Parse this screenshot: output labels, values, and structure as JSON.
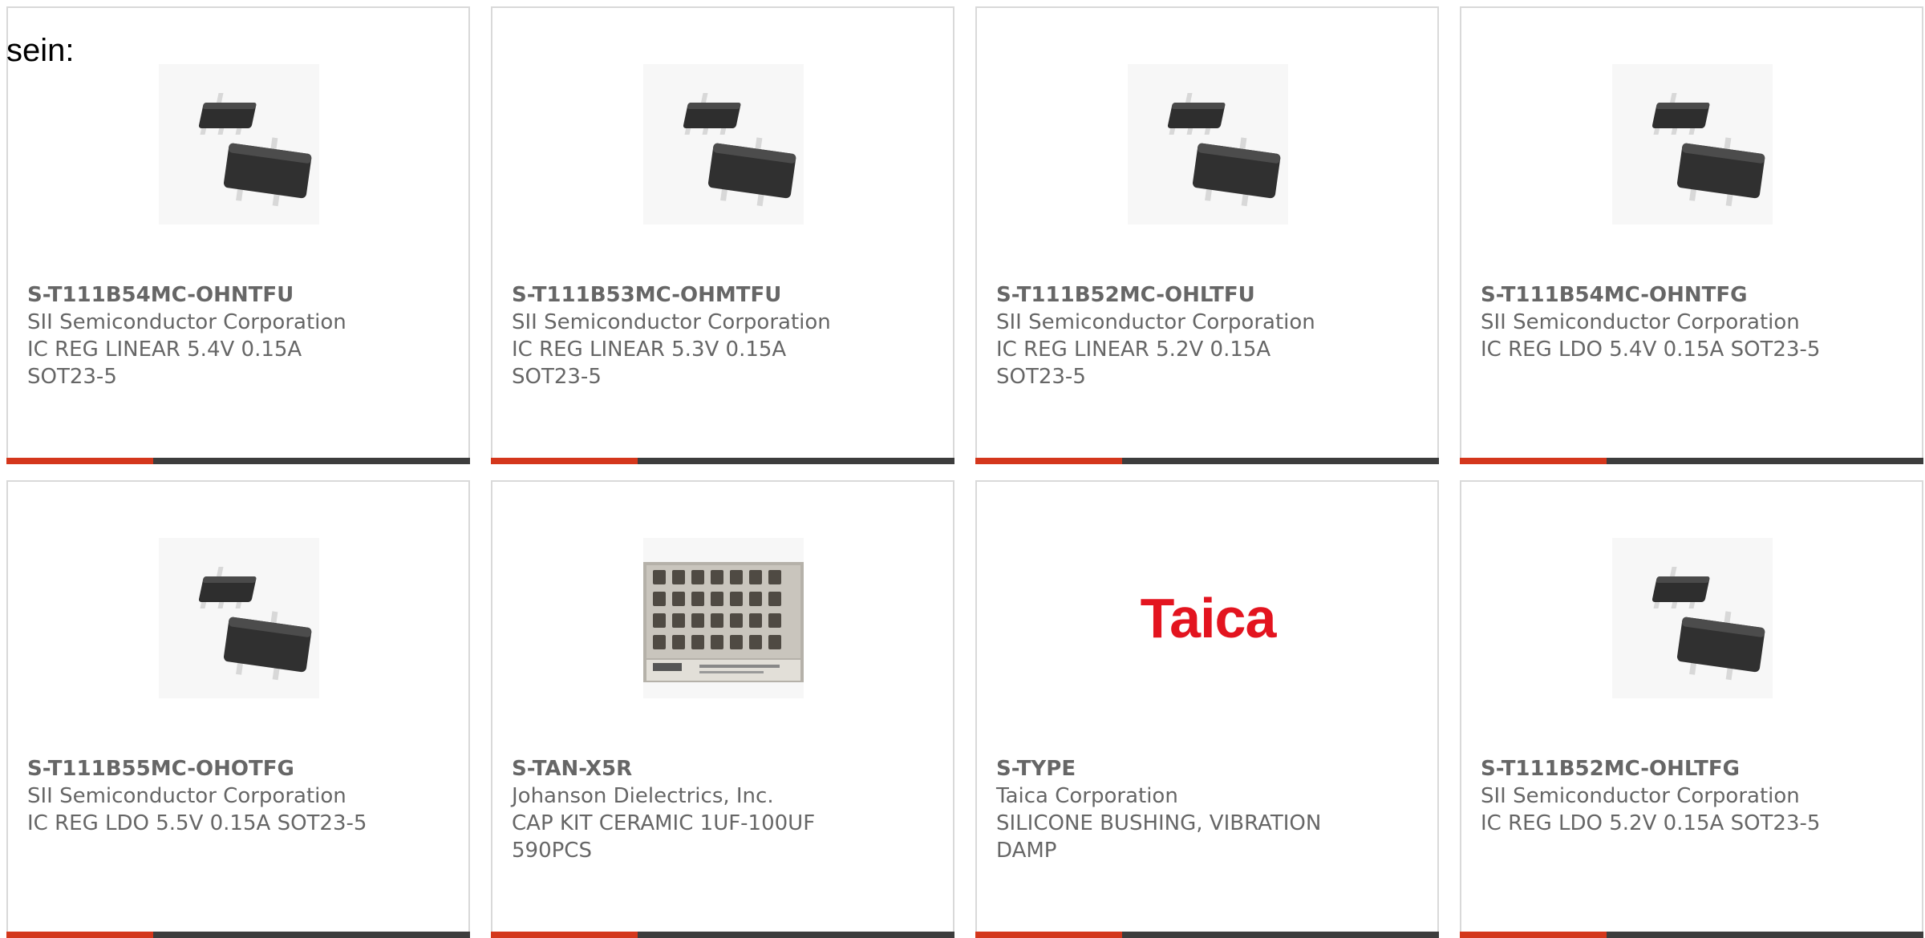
{
  "page": {
    "fragment_label": "sein:"
  },
  "colors": {
    "accent_bar": "#d4371c",
    "dark_bar": "#3d3d3d",
    "text": "#666666",
    "card_border": "#d9d9d9",
    "taica_red": "#e3141f"
  },
  "products": [
    {
      "part": "S-T111B54MC-OHNTFU",
      "manufacturer": "SII Semiconductor Corporation",
      "description": "IC REG LINEAR 5.4V 0.15A SOT23-5",
      "image": "sot23-5-package-icon"
    },
    {
      "part": "S-T111B53MC-OHMTFU",
      "manufacturer": "SII Semiconductor Corporation",
      "description": "IC REG LINEAR 5.3V 0.15A SOT23-5",
      "image": "sot23-5-package-icon"
    },
    {
      "part": "S-T111B52MC-OHLTFU",
      "manufacturer": "SII Semiconductor Corporation",
      "description": "IC REG LINEAR 5.2V 0.15A SOT23-5",
      "image": "sot23-5-package-icon"
    },
    {
      "part": "S-T111B54MC-OHNTFG",
      "manufacturer": "SII Semiconductor Corporation",
      "description": "IC REG LDO 5.4V 0.15A SOT23-5",
      "image": "sot23-5-package-icon"
    },
    {
      "part": "S-T111B55MC-OHOTFG",
      "manufacturer": "SII Semiconductor Corporation",
      "description": "IC REG LDO 5.5V 0.15A SOT23-5",
      "image": "sot23-5-package-icon"
    },
    {
      "part": "S-TAN-X5R",
      "manufacturer": "Johanson Dielectrics, Inc.",
      "description": "CAP KIT CERAMIC 1UF-100UF 590PCS",
      "image": "capacitor-kit-icon"
    },
    {
      "part": "S-TYPE",
      "manufacturer": "Taica Corporation",
      "description": "SILICONE BUSHING, VIBRATION DAMP",
      "image": "taica-logo",
      "logo_text": "Taica"
    },
    {
      "part": "S-T111B52MC-OHLTFG",
      "manufacturer": "SII Semiconductor Corporation",
      "description": "IC REG LDO 5.2V 0.15A SOT23-5",
      "image": "sot23-5-package-icon"
    }
  ]
}
